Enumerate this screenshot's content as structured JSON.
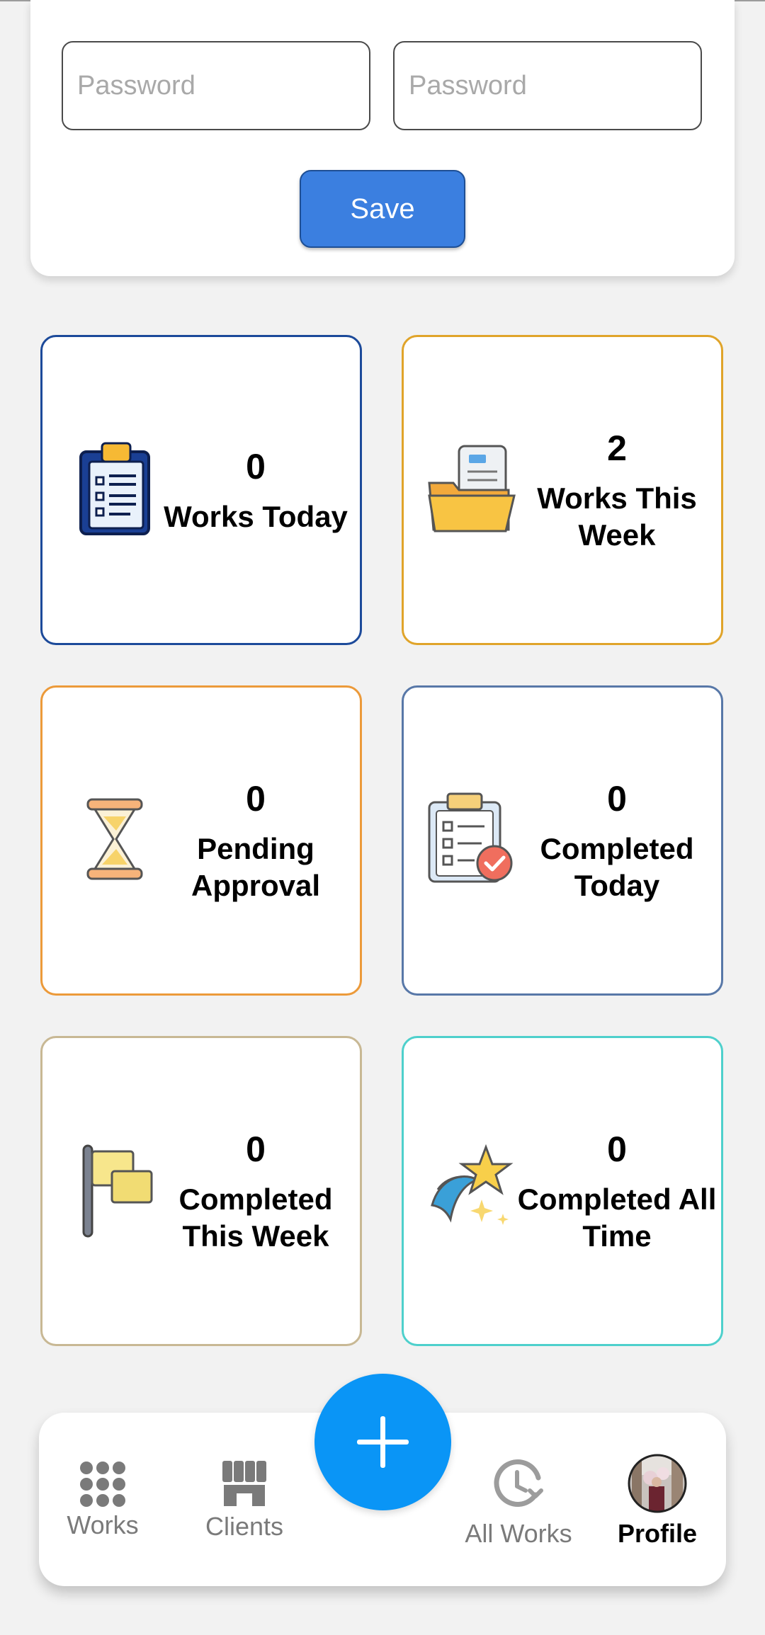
{
  "form": {
    "password_placeholder_1": "Password",
    "password_placeholder_2": "Password",
    "save_label": "Save"
  },
  "stats": [
    {
      "value": "0",
      "label": "Works Today",
      "border": "#1c4a9a",
      "icon": "clipboard-list-icon"
    },
    {
      "value": "2",
      "label": "Works This Week",
      "border": "#e0a42a",
      "icon": "folder-document-icon"
    },
    {
      "value": "0",
      "label": "Pending Approval",
      "border": "#ec9a3a",
      "icon": "hourglass-icon"
    },
    {
      "value": "0",
      "label": "Completed Today",
      "border": "#5878a8",
      "icon": "clipboard-check-icon"
    },
    {
      "value": "0",
      "label": "Completed This Week",
      "border": "#c8b894",
      "icon": "flag-icon"
    },
    {
      "value": "0",
      "label": "Completed All Time",
      "border": "#4ed0cc",
      "icon": "shooting-star-icon"
    }
  ],
  "nav": {
    "items": [
      {
        "label": "Works",
        "icon": "grid-dots-icon"
      },
      {
        "label": "Clients",
        "icon": "store-icon"
      },
      {
        "label": "All Works",
        "icon": "history-clock-icon"
      },
      {
        "label": "Profile",
        "icon": "profile-avatar"
      }
    ],
    "fab_icon": "plus-icon",
    "active_color": "#000000",
    "inactive_color": "#7a7a7a",
    "fab_color": "#0a95f6"
  }
}
